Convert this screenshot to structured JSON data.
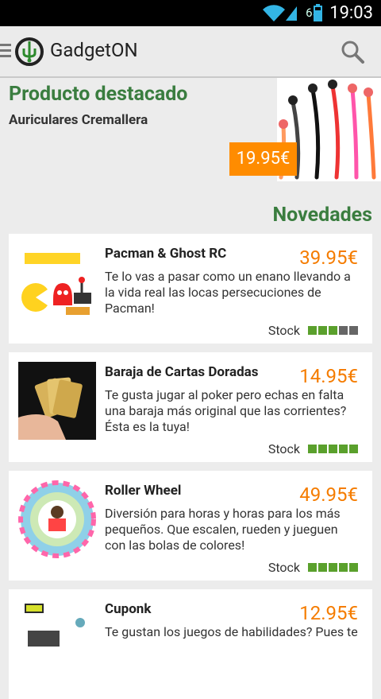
{
  "status": {
    "battery_pct": "65",
    "time": "19:03"
  },
  "app": {
    "title": "GadgetON"
  },
  "featured": {
    "kicker": "Producto destacado",
    "name": "Auriculares Cremallera",
    "price": "19.95€"
  },
  "news": {
    "title": "Novedades"
  },
  "products": [
    {
      "title": "Pacman & Ghost RC",
      "price": "39.95€",
      "desc": "Te lo vas a pasar como un enano llevando a la vida real las locas persecuciones de Pacman!",
      "stock_label": "Stock",
      "stock_level": 3,
      "stock_max": 5
    },
    {
      "title": "Baraja de Cartas Doradas",
      "price": "14.95€",
      "desc": "Te gusta jugar al poker pero echas en falta una baraja más original que las corrientes? Ésta es la tuya!",
      "stock_label": "Stock",
      "stock_level": 5,
      "stock_max": 5
    },
    {
      "title": "Roller Wheel",
      "price": "49.95€",
      "desc": "Diversión para horas y horas para los más pequeños. Que escalen, rueden y jueguen con las bolas de colores!",
      "stock_label": "Stock",
      "stock_level": 5,
      "stock_max": 5
    },
    {
      "title": "Cuponk",
      "price": "12.95€",
      "desc": "Te gustan los juegos de habilidades? Pues te",
      "stock_label": "",
      "stock_level": 0,
      "stock_max": 5
    }
  ],
  "icons": {
    "menu": "hamburger-icon",
    "logo": "gadgeton-logo-icon",
    "search": "search-icon"
  },
  "colors": {
    "accent_green": "#3a7d3f",
    "price_orange": "#f57c00",
    "stock_on": "#5aa02c",
    "stock_off": "#666666"
  }
}
